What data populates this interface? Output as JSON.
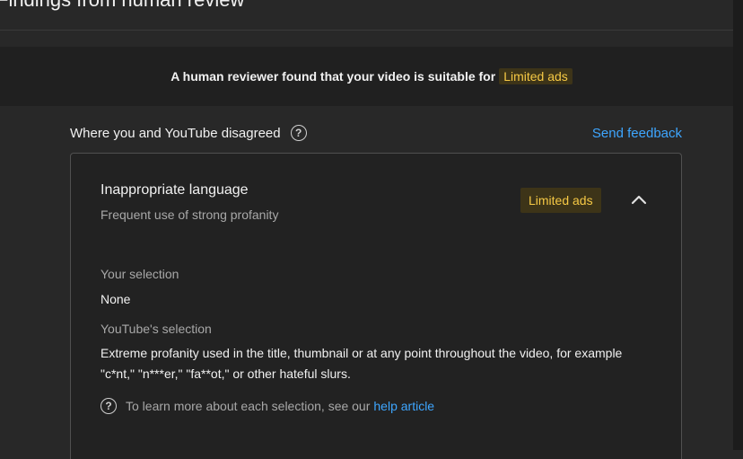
{
  "header": {
    "title": "Findings from human review"
  },
  "banner": {
    "text": "A human reviewer found that your video is suitable for",
    "badge": "Limited ads",
    "badge_color": "#f6c945"
  },
  "section": {
    "label": "Where you and YouTube disagreed",
    "help_icon": "question-circle-icon",
    "feedback_link": "Send feedback"
  },
  "finding": {
    "title": "Inappropriate language",
    "subtitle": "Frequent use of strong profanity",
    "badge": "Limited ads",
    "expand_icon": "chevron-up-icon",
    "your_selection_label": "Your selection",
    "your_selection_value": "None",
    "youtube_selection_label": "YouTube's selection",
    "youtube_selection_value": "Extreme profanity used in the title, thumbnail or at any point throughout the video, for example \"c*nt,\" \"n***er,\" \"fa**ot,\" or other hateful slurs.",
    "learn_text": "To learn more about each selection, see our",
    "learn_link": "help article"
  },
  "colors": {
    "link": "#3ea6ff",
    "badge_bg": "#3d3418",
    "badge_text": "#f6c945"
  }
}
